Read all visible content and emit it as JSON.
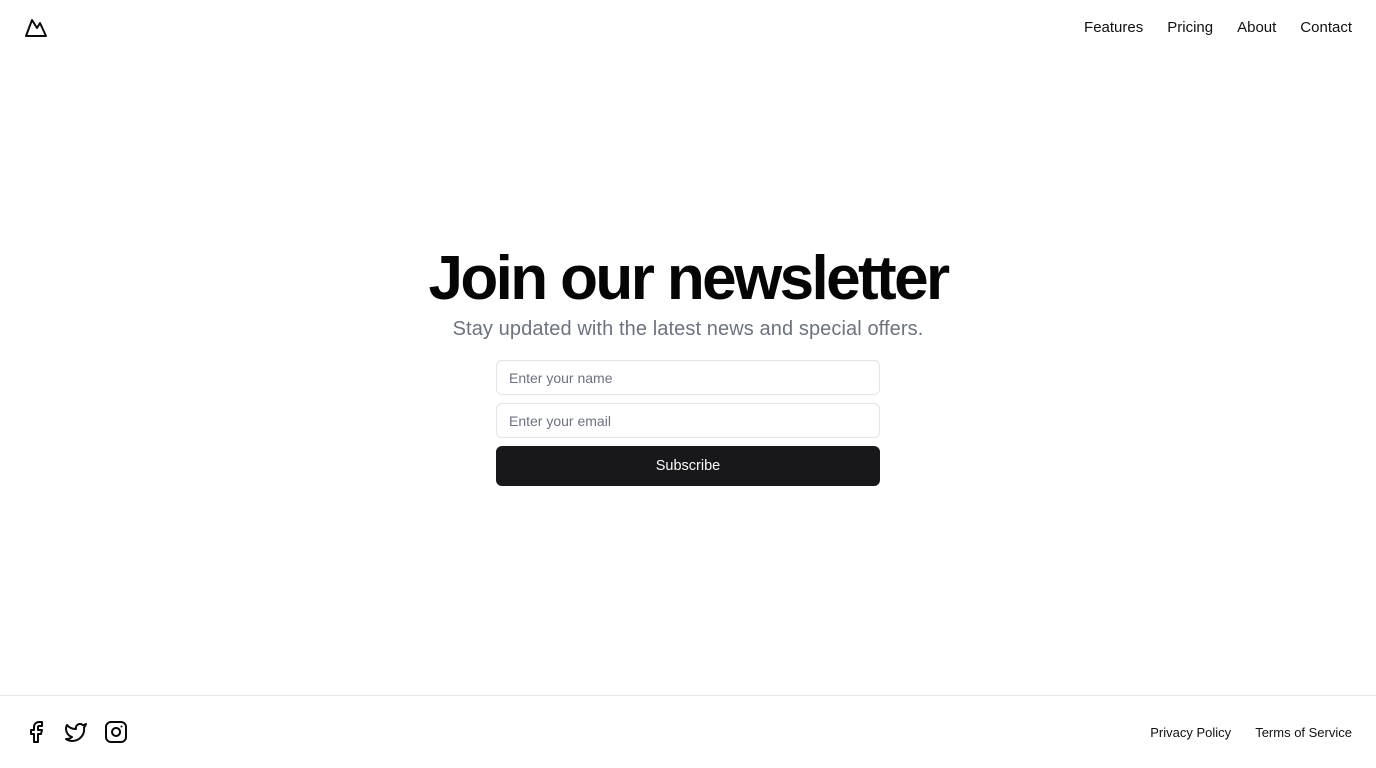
{
  "header": {
    "logo_icon": "mountain-logo-icon",
    "nav": [
      {
        "label": "Features"
      },
      {
        "label": "Pricing"
      },
      {
        "label": "About"
      },
      {
        "label": "Contact"
      }
    ]
  },
  "hero": {
    "title": "Join our newsletter",
    "subtitle": "Stay updated with the latest news and special offers."
  },
  "form": {
    "name_placeholder": "Enter your name",
    "name_value": "",
    "email_placeholder": "Enter your email",
    "email_value": "",
    "submit_label": "Subscribe"
  },
  "footer": {
    "socials": [
      "facebook-icon",
      "twitter-icon",
      "instagram-icon"
    ],
    "links": [
      {
        "label": "Privacy Policy"
      },
      {
        "label": "Terms of Service"
      }
    ]
  },
  "colors": {
    "button_bg": "#18181b",
    "button_text": "#fafafa",
    "subtitle": "#6b7280",
    "border": "#e4e4e7"
  }
}
